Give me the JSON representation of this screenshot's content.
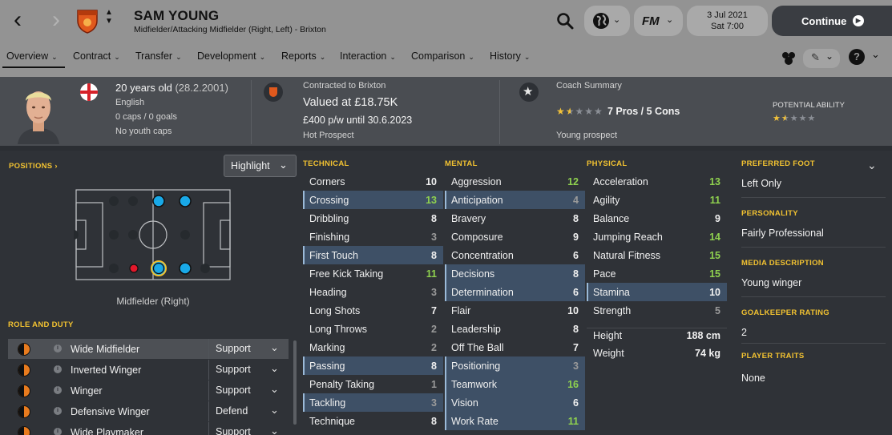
{
  "header": {
    "player_name": "SAM YOUNG",
    "player_subtitle": "Midfielder/Attacking Midfielder (Right, Left) - Brixton",
    "date": "3 Jul 2021",
    "time": "Sat 7:00",
    "continue_label": "Continue",
    "fm_label": "FM",
    "icons": [
      "back-arrow-icon",
      "forward-arrow-icon",
      "club-crest-icon",
      "search-icon",
      "globe-icon",
      "fm-logo-icon",
      "continue-arrow-icon"
    ]
  },
  "tabs": [
    {
      "label": "Overview",
      "active": true
    },
    {
      "label": "Contract"
    },
    {
      "label": "Transfer"
    },
    {
      "label": "Development"
    },
    {
      "label": "Reports"
    },
    {
      "label": "Interaction"
    },
    {
      "label": "Comparison"
    },
    {
      "label": "History"
    }
  ],
  "summary": {
    "age": "20 years old",
    "dob": "(28.2.2001)",
    "nationality": "English",
    "caps": "0 caps / 0 goals",
    "youth_caps": "No youth caps",
    "contract_label": "Contracted to Brixton",
    "value": "Valued at £18.75K",
    "wage": "£400 p/w until 30.6.2023",
    "status": "Hot Prospect",
    "coach_label": "Coach Summary",
    "coach_stars": 1.5,
    "pros_cons": "7 Pros / 5 Cons",
    "coach_verdict": "Young prospect",
    "potential_label": "POTENTIAL ABILITY",
    "potential_stars": 1.5
  },
  "positions": {
    "heading": "POSITIONS",
    "highlight_label": "Highlight",
    "selected_position": "Midfielder (Right)"
  },
  "roles": {
    "heading": "ROLE AND DUTY",
    "items": [
      {
        "name": "Wide Midfielder",
        "duty": "Support",
        "selected": true
      },
      {
        "name": "Inverted Winger",
        "duty": "Support"
      },
      {
        "name": "Winger",
        "duty": "Support"
      },
      {
        "name": "Defensive Winger",
        "duty": "Defend"
      },
      {
        "name": "Wide Playmaker",
        "duty": "Support"
      }
    ]
  },
  "technical": {
    "heading": "TECHNICAL",
    "items": [
      {
        "name": "Corners",
        "value": 10
      },
      {
        "name": "Crossing",
        "value": 13,
        "hl": true
      },
      {
        "name": "Dribbling",
        "value": 8
      },
      {
        "name": "Finishing",
        "value": 3
      },
      {
        "name": "First Touch",
        "value": 8,
        "hl": true
      },
      {
        "name": "Free Kick Taking",
        "value": 11
      },
      {
        "name": "Heading",
        "value": 3
      },
      {
        "name": "Long Shots",
        "value": 7
      },
      {
        "name": "Long Throws",
        "value": 2
      },
      {
        "name": "Marking",
        "value": 2
      },
      {
        "name": "Passing",
        "value": 8,
        "hl": true
      },
      {
        "name": "Penalty Taking",
        "value": 1
      },
      {
        "name": "Tackling",
        "value": 3,
        "hl": true
      },
      {
        "name": "Technique",
        "value": 8
      }
    ]
  },
  "mental": {
    "heading": "MENTAL",
    "items": [
      {
        "name": "Aggression",
        "value": 12
      },
      {
        "name": "Anticipation",
        "value": 4,
        "hl": true
      },
      {
        "name": "Bravery",
        "value": 8
      },
      {
        "name": "Composure",
        "value": 9
      },
      {
        "name": "Concentration",
        "value": 6
      },
      {
        "name": "Decisions",
        "value": 8,
        "hl": true
      },
      {
        "name": "Determination",
        "value": 6,
        "hl": true
      },
      {
        "name": "Flair",
        "value": 10
      },
      {
        "name": "Leadership",
        "value": 8
      },
      {
        "name": "Off The Ball",
        "value": 7
      },
      {
        "name": "Positioning",
        "value": 3,
        "hl": true
      },
      {
        "name": "Teamwork",
        "value": 16,
        "hl": true
      },
      {
        "name": "Vision",
        "value": 6,
        "hl": true
      },
      {
        "name": "Work Rate",
        "value": 11,
        "hl": true
      }
    ]
  },
  "physical": {
    "heading": "PHYSICAL",
    "items": [
      {
        "name": "Acceleration",
        "value": 13
      },
      {
        "name": "Agility",
        "value": 11
      },
      {
        "name": "Balance",
        "value": 9
      },
      {
        "name": "Jumping Reach",
        "value": 14
      },
      {
        "name": "Natural Fitness",
        "value": 15
      },
      {
        "name": "Pace",
        "value": 15
      },
      {
        "name": "Stamina",
        "value": 10,
        "hl": true
      },
      {
        "name": "Strength",
        "value": 5
      }
    ],
    "height_label": "Height",
    "height": "188 cm",
    "weight_label": "Weight",
    "weight": "74 kg"
  },
  "right_panel": {
    "preferred_foot_label": "PREFERRED FOOT",
    "preferred_foot": "Left Only",
    "personality_label": "PERSONALITY",
    "personality": "Fairly Professional",
    "media_label": "MEDIA DESCRIPTION",
    "media": "Young winger",
    "gk_label": "GOALKEEPER RATING",
    "gk_value": "2",
    "traits_label": "PLAYER TRAITS",
    "traits": "None"
  },
  "colors": {
    "accent_yellow": "#f2c231",
    "attr_green": "#8fd14f",
    "attr_white": "#f0f0f0",
    "attr_grey": "#9a9a9a",
    "natural_pos": "#19a9e8",
    "weak_pos": "#e3182b"
  }
}
